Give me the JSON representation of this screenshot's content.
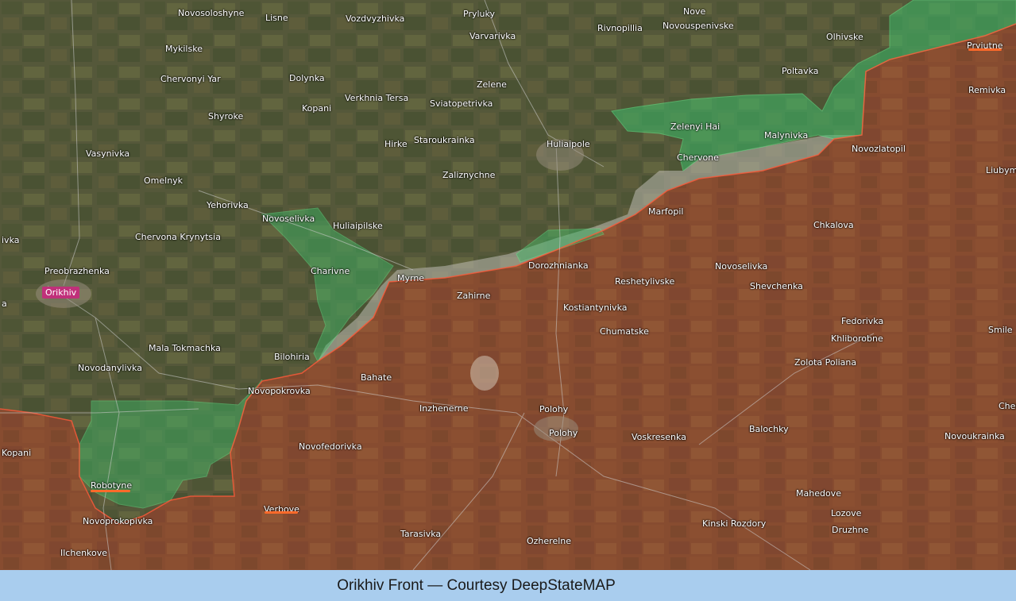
{
  "caption": "Orikhiv Front — Courtesy DeepStateMAP",
  "colors": {
    "occupied_fill": "#8a4a2e",
    "liberated_fill": "#3dbd6a",
    "contested_fill": "#c8c8c0",
    "frontline": "#ff5a3a",
    "terrain": "#5b5c3a",
    "highlight_underline": "#ff6a2a",
    "city_tag": "#c0307a"
  },
  "labels": [
    {
      "id": "novosoloshyne",
      "text": "Novosoloshyne"
    },
    {
      "id": "lisne",
      "text": "Lisne"
    },
    {
      "id": "vozdvyzhivka",
      "text": "Vozdvyzhivka"
    },
    {
      "id": "pryluky",
      "text": "Pryluky"
    },
    {
      "id": "nove",
      "text": "Nove"
    },
    {
      "id": "novouspenivske",
      "text": "Novouspenivske"
    },
    {
      "id": "rivnopillia",
      "text": "Rivnopillia"
    },
    {
      "id": "varvarivka",
      "text": "Varvarivka"
    },
    {
      "id": "olhivske",
      "text": "Olhivske"
    },
    {
      "id": "pryiutne",
      "text": "Pryiutne"
    },
    {
      "id": "mykilske",
      "text": "Mykilske"
    },
    {
      "id": "poltavka",
      "text": "Poltavka"
    },
    {
      "id": "chervonyi-yar",
      "text": "Chervonyi Yar"
    },
    {
      "id": "dolynka",
      "text": "Dolynka"
    },
    {
      "id": "zelene",
      "text": "Zelene"
    },
    {
      "id": "remivka",
      "text": "Remivka"
    },
    {
      "id": "verkhnia-tersa",
      "text": "Verkhnia Tersa"
    },
    {
      "id": "sviatopetrivka",
      "text": "Sviatopetrivka"
    },
    {
      "id": "kopani-n",
      "text": "Kopani"
    },
    {
      "id": "shyroke",
      "text": "Shyroke"
    },
    {
      "id": "zelenyi-hai",
      "text": "Zelenyi Hai"
    },
    {
      "id": "malynivka",
      "text": "Malynivka"
    },
    {
      "id": "hirke",
      "text": "Hirke"
    },
    {
      "id": "staroukrainka",
      "text": "Staroukrainka"
    },
    {
      "id": "huliaipole",
      "text": "Huliaipole"
    },
    {
      "id": "novozlatopil",
      "text": "Novozlatopil"
    },
    {
      "id": "vasynivka",
      "text": "Vasynivka"
    },
    {
      "id": "chervone",
      "text": "Chervone"
    },
    {
      "id": "liubym",
      "text": "Liubym"
    },
    {
      "id": "zaliznychne",
      "text": "Zaliznychne"
    },
    {
      "id": "omelnyk",
      "text": "Omelnyk"
    },
    {
      "id": "yehorivka",
      "text": "Yehorivka"
    },
    {
      "id": "marfopil",
      "text": "Marfopil"
    },
    {
      "id": "novoselivka-w",
      "text": "Novoselivka"
    },
    {
      "id": "huliaipilske",
      "text": "Huliaipilske"
    },
    {
      "id": "chkalova",
      "text": "Chkalova"
    },
    {
      "id": "ivka",
      "text": "ivka"
    },
    {
      "id": "chervona-krynytsia",
      "text": "Chervona Krynytsia"
    },
    {
      "id": "dorozhnianka",
      "text": "Dorozhnianka"
    },
    {
      "id": "novoselivka-e",
      "text": "Novoselivka"
    },
    {
      "id": "preobrazhenka",
      "text": "Preobrazhenka"
    },
    {
      "id": "charivne",
      "text": "Charivne"
    },
    {
      "id": "myrne",
      "text": "Myrne"
    },
    {
      "id": "reshetylivske",
      "text": "Reshetylivske"
    },
    {
      "id": "shevchenka",
      "text": "Shevchenka"
    },
    {
      "id": "orikhiv",
      "text": "Orikhiv"
    },
    {
      "id": "zahirne",
      "text": "Zahirne"
    },
    {
      "id": "a",
      "text": "a"
    },
    {
      "id": "kostiantynivka",
      "text": "Kostiantynivka"
    },
    {
      "id": "fedorivka",
      "text": "Fedorivka"
    },
    {
      "id": "smile",
      "text": "Smile"
    },
    {
      "id": "chumatske",
      "text": "Chumatske"
    },
    {
      "id": "khliborobne",
      "text": "Khliborobne"
    },
    {
      "id": "mala-tokmachka",
      "text": "Mala Tokmachka"
    },
    {
      "id": "bilohiria",
      "text": "Bilohiria"
    },
    {
      "id": "zolota-poliana",
      "text": "Zolota Poliana"
    },
    {
      "id": "novodanylivka",
      "text": "Novodanylivka"
    },
    {
      "id": "bahate",
      "text": "Bahate"
    },
    {
      "id": "novopokrovka",
      "text": "Novopokrovka"
    },
    {
      "id": "inzhenerne",
      "text": "Inzhenerne"
    },
    {
      "id": "polohy-1",
      "text": "Polohy"
    },
    {
      "id": "cher",
      "text": "Cher"
    },
    {
      "id": "balochky",
      "text": "Balochky"
    },
    {
      "id": "polohy-2",
      "text": "Polohy"
    },
    {
      "id": "voskresenka",
      "text": "Voskresenka"
    },
    {
      "id": "novoukrainka",
      "text": "Novoukrainka"
    },
    {
      "id": "novofedorivka",
      "text": "Novofedorivka"
    },
    {
      "id": "kopani-s",
      "text": "Kopani"
    },
    {
      "id": "robotyne",
      "text": "Robotyne"
    },
    {
      "id": "mahedove",
      "text": "Mahedove"
    },
    {
      "id": "verbove",
      "text": "Verbove"
    },
    {
      "id": "lozove",
      "text": "Lozove"
    },
    {
      "id": "novoprokopivka",
      "text": "Novoprokopivka"
    },
    {
      "id": "kinski-rozdory",
      "text": "Kinski Rozdory"
    },
    {
      "id": "druzhne",
      "text": "Druzhne"
    },
    {
      "id": "tarasivka",
      "text": "Tarasivka"
    },
    {
      "id": "ozherelne",
      "text": "Ozherelne"
    },
    {
      "id": "ilchenkove",
      "text": "Ilchenkove"
    }
  ]
}
